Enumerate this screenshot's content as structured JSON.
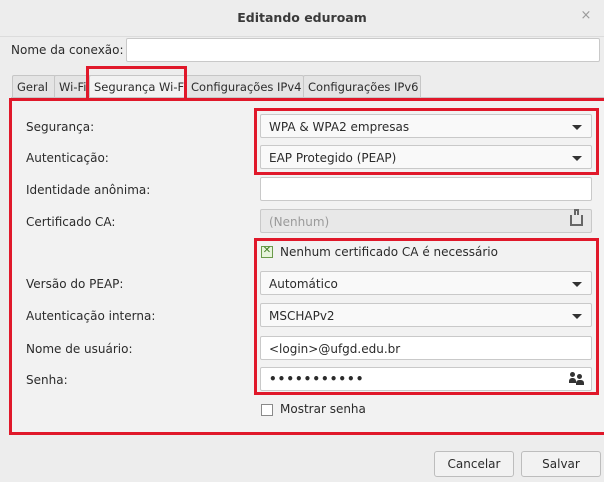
{
  "window": {
    "title": "Editando eduroam",
    "close_symbol": "×"
  },
  "connection": {
    "label": "Nome da conexão:",
    "value": ""
  },
  "tabs": [
    {
      "label": "Geral"
    },
    {
      "label": "Wi-Fi"
    },
    {
      "label": "Segurança Wi-Fi"
    },
    {
      "label": "Configurações IPv4"
    },
    {
      "label": "Configurações IPv6"
    }
  ],
  "form": {
    "security": {
      "label": "Segurança:",
      "value": "WPA & WPA2 empresas"
    },
    "authentication": {
      "label": "Autenticação:",
      "value": "EAP Protegido (PEAP)"
    },
    "anonymous_identity": {
      "label": "Identidade anônima:",
      "value": ""
    },
    "ca_certificate": {
      "label": "Certificado CA:",
      "value": "(Nenhum)"
    },
    "no_ca_required": {
      "label": "Nenhum certificado CA é necessário",
      "checked": true
    },
    "peap_version": {
      "label": "Versão do PEAP:",
      "value": "Automático"
    },
    "inner_auth": {
      "label": "Autenticação interna:",
      "value": "MSCHAPv2"
    },
    "username": {
      "label": "Nome de usuário:",
      "value": "<login>@ufgd.edu.br"
    },
    "password": {
      "label": "Senha:",
      "value": "•••••••••••"
    },
    "show_password": {
      "label": "Mostrar senha",
      "checked": false
    }
  },
  "buttons": {
    "cancel": "Cancelar",
    "save": "Salvar"
  },
  "colors": {
    "highlight": "#e0182a",
    "background": "#ededed"
  }
}
